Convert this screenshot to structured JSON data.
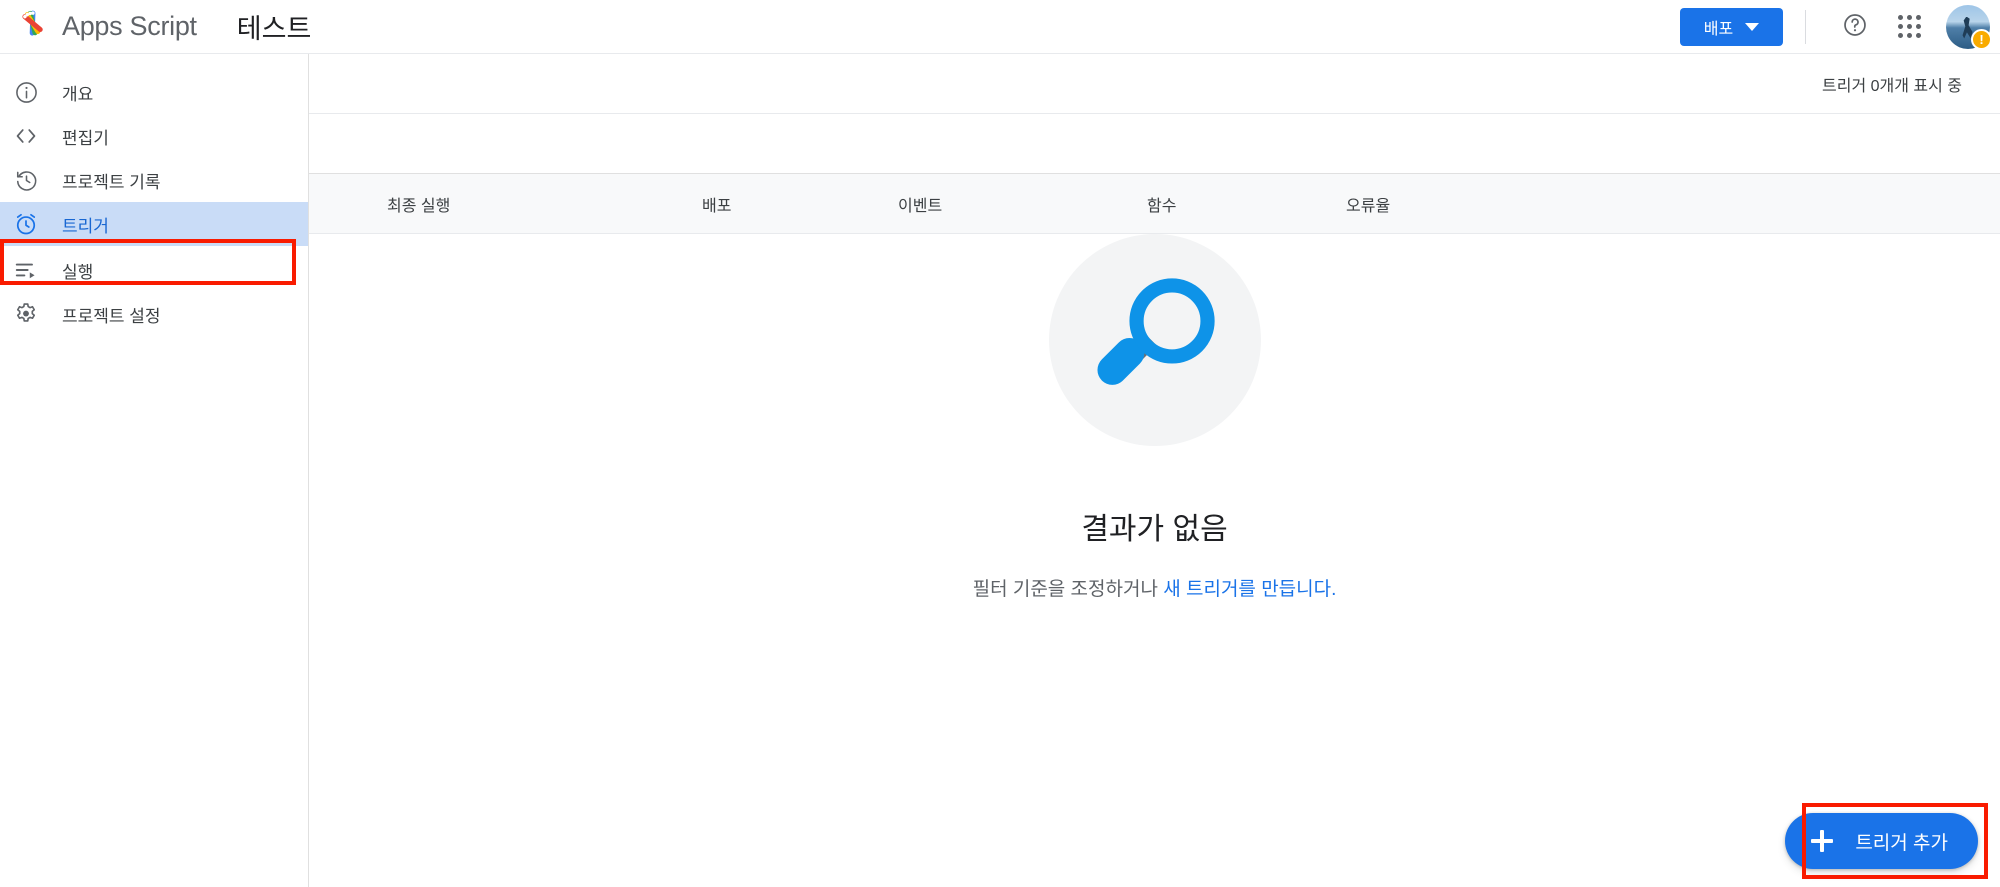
{
  "header": {
    "logo_icon": "apps-script-logo",
    "brand": "Apps Script",
    "project_title": "테스트",
    "deploy_label": "배포",
    "deploy_caret_icon": "chevron-down-icon",
    "help_icon": "help-circle-icon",
    "apps_icon": "apps-grid-icon",
    "avatar_icon": "user-avatar",
    "avatar_badge": "!"
  },
  "sidebar": {
    "items": [
      {
        "label": "개요",
        "icon": "info-circle-icon",
        "active": false
      },
      {
        "label": "편집기",
        "icon": "code-brackets-icon",
        "active": false
      },
      {
        "label": "프로젝트 기록",
        "icon": "history-clock-icon",
        "active": false
      },
      {
        "label": "트리거",
        "icon": "alarm-clock-icon",
        "active": true
      },
      {
        "label": "실행",
        "icon": "executions-list-icon",
        "active": false
      },
      {
        "label": "프로젝트 설정",
        "icon": "gear-icon",
        "active": false
      }
    ]
  },
  "main": {
    "trigger_count_text": "트리거 0개개 표시 중",
    "table_headers": [
      "최종 실행",
      "배포",
      "이벤트",
      "함수",
      "오류율"
    ],
    "empty_state": {
      "illustration_icon": "magnifier-search-icon",
      "title": "결과가 없음",
      "subtitle_prefix": "필터 기준을 조정하거나 ",
      "subtitle_link": "새 트리거를 만듭니다."
    },
    "fab": {
      "plus_icon": "plus-icon",
      "label": "트리거 추가"
    }
  },
  "colors": {
    "accent_blue": "#1a73e8",
    "nav_active_bg": "#c9dcf7",
    "nav_active_text": "#1967d2",
    "annotation_red": "#f91b00",
    "empty_circle_bg": "#f3f4f5",
    "magnifier_blue": "#0e93e8",
    "badge_orange": "#f9ab00"
  }
}
